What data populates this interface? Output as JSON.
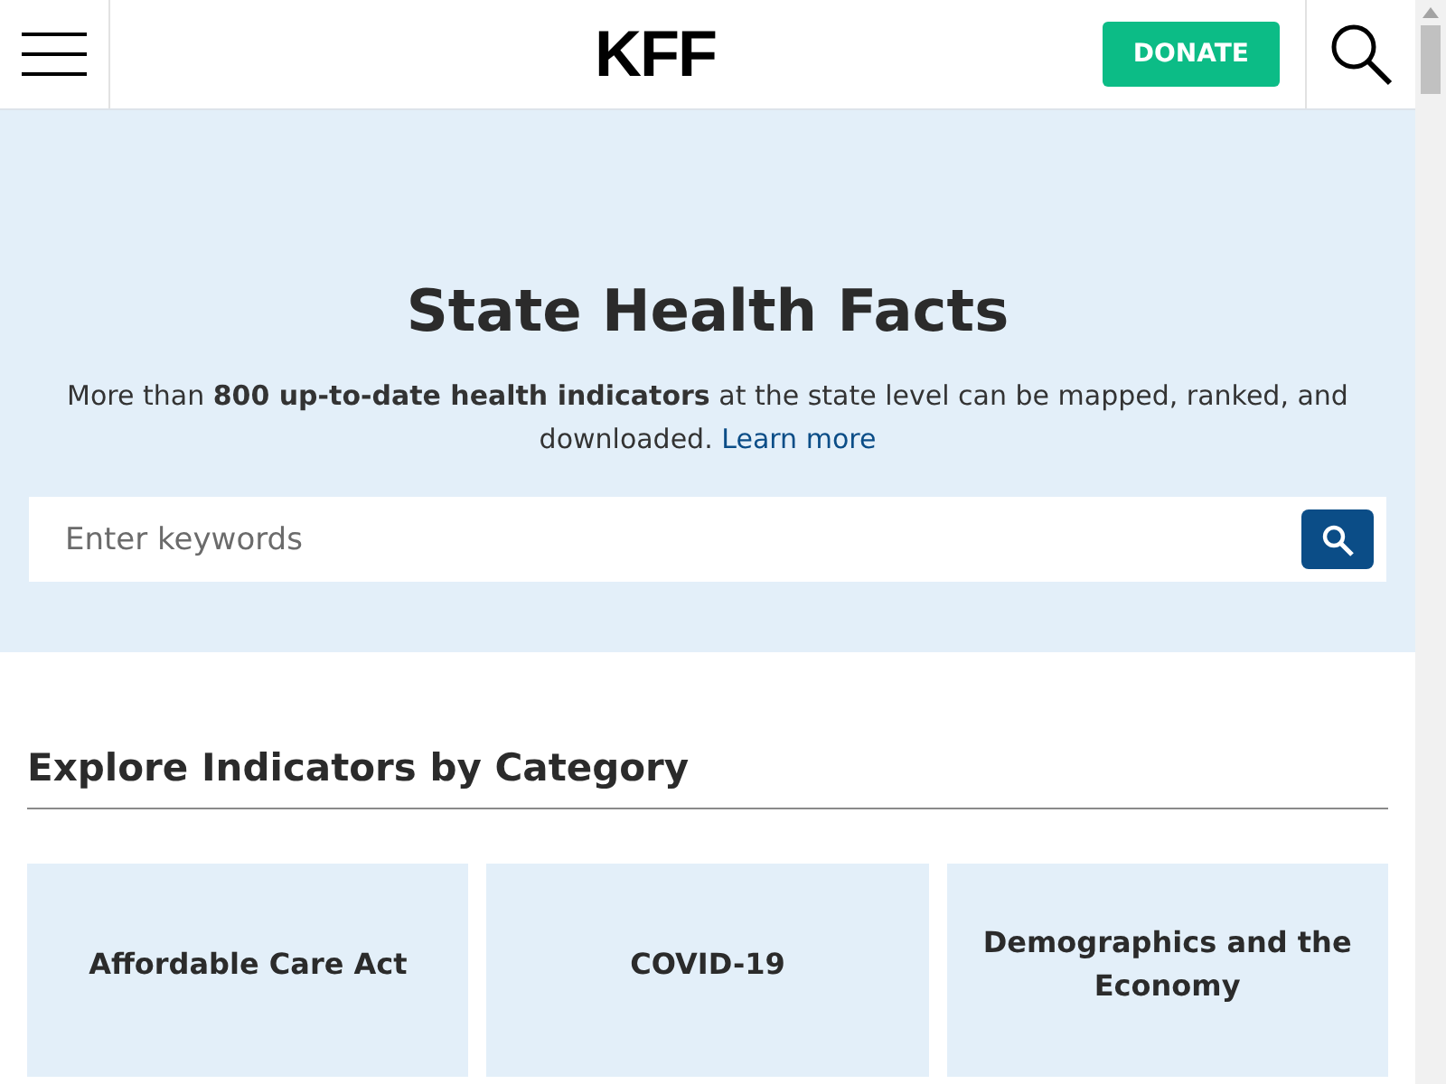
{
  "header": {
    "logo": "KFF",
    "donate_button": "DONATE"
  },
  "hero": {
    "title": "State Health Facts",
    "description": "More than **800 up-to-date health indicators** at the state level can be mapped, ranked, and downloaded.",
    "link": "Learn more",
    "search": {
      "placeholder": "Enter keywords"
    }
  },
  "section": {
    "heading": "Explore Indicators by Category",
    "categories": [
      "Affordable Care Act",
      "COVID-19",
      "Demographics and the Economy"
    ]
  }
}
